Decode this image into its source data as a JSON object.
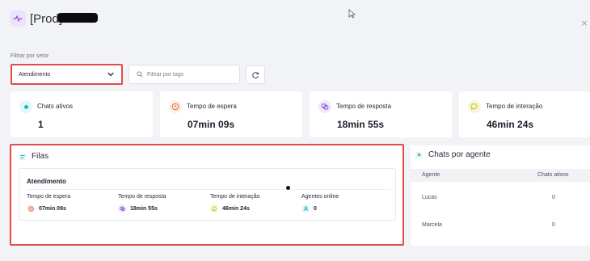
{
  "header": {
    "title": "[Prod]",
    "icon": "activity-icon",
    "close_icon": "close-icon"
  },
  "filters": {
    "label": "Filtrar por setor",
    "sector_value": "Atendimento",
    "tags_placeholder": "Filtrar por tags",
    "refresh_icon": "refresh-icon"
  },
  "stats": [
    {
      "label": "Chats ativos",
      "value": "1",
      "icon": "live-dot-icon",
      "color": "#1fb3c4"
    },
    {
      "label": "Tempo de espera",
      "value": "07min 09s",
      "icon": "clock-icon",
      "color": "#d9673e"
    },
    {
      "label": "Tempo de resposta",
      "value": "18min 55s",
      "icon": "chat-bubbles-icon",
      "color": "#8a4fd6"
    },
    {
      "label": "Tempo de interação",
      "value": "46min 24s",
      "icon": "message-icon",
      "color": "#c9c420"
    }
  ],
  "filas": {
    "title": "Filas",
    "queue": {
      "name": "Atendimento",
      "metrics": [
        {
          "label": "Tempo de espera",
          "value": "07min 09s",
          "icon": "clock-icon"
        },
        {
          "label": "Tempo de resposta",
          "value": "18min 55s",
          "icon": "chat-bubbles-icon"
        },
        {
          "label": "Tempo de interação",
          "value": "46min 24s",
          "icon": "message-icon"
        },
        {
          "label": "Agentes online",
          "value": "0",
          "icon": "agent-icon"
        }
      ]
    }
  },
  "agents": {
    "title": "Chats por agente",
    "columns": [
      "Agente",
      "Chats ativos"
    ],
    "rows": [
      {
        "name": "Lucas",
        "chats": "0"
      },
      {
        "name": "Marcela",
        "chats": "0"
      }
    ]
  },
  "colors": {
    "highlight": "#e24b4b",
    "background": "#f2f3f6"
  }
}
